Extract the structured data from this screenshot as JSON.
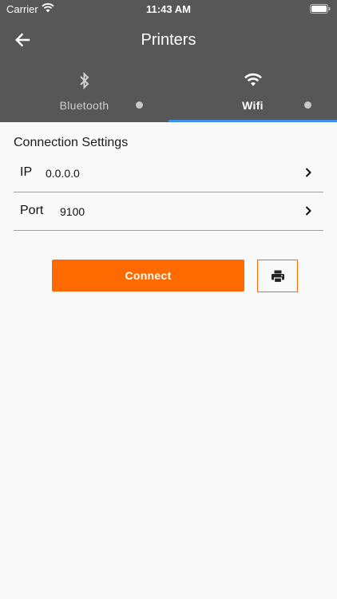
{
  "status_bar": {
    "carrier": "Carrier",
    "time": "11:43 AM"
  },
  "header": {
    "title": "Printers",
    "back_icon": "arrow-left-icon"
  },
  "tabs": [
    {
      "label": "Bluetooth",
      "icon": "bluetooth-icon",
      "selected": false
    },
    {
      "label": "Wifi",
      "icon": "wifi-icon",
      "selected": true
    }
  ],
  "settings": {
    "title": "Connection Settings",
    "rows": [
      {
        "label": "IP",
        "value": "0.0.0.0"
      },
      {
        "label": "Port",
        "value": "9100"
      }
    ]
  },
  "actions": {
    "connect_label": "Connect",
    "print_icon": "printer-icon"
  },
  "colors": {
    "appbar": "#575757",
    "accent": "#ff6a00",
    "tab_indicator": "#3d8ee6",
    "background": "#f9f9f9"
  }
}
